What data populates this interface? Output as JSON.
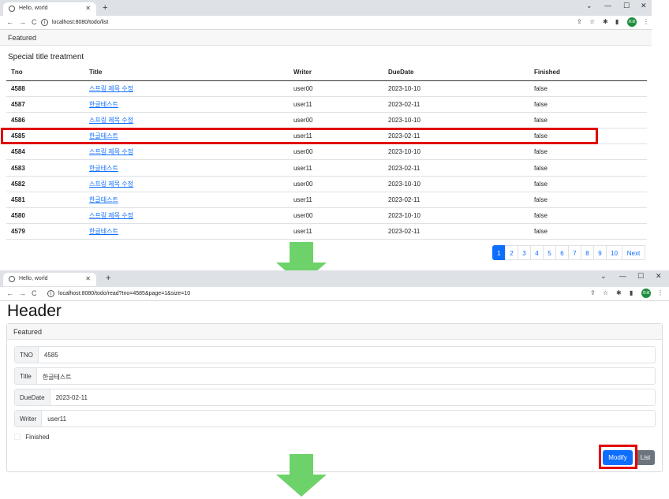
{
  "list_window": {
    "tab_title": "Hello, world",
    "url": "localhost:8080/todo/list",
    "card_header": "Featured",
    "card_title": "Special title treatment",
    "columns": [
      "Tno",
      "Title",
      "Writer",
      "DueDate",
      "Finished"
    ],
    "rows": [
      {
        "tno": "4588",
        "title": "스프링 제목 수정",
        "writer": "user00",
        "due": "2023-10-10",
        "finished": "false"
      },
      {
        "tno": "4587",
        "title": "한글테스트",
        "writer": "user11",
        "due": "2023-02-11",
        "finished": "false"
      },
      {
        "tno": "4586",
        "title": "스프링 제목 수정",
        "writer": "user00",
        "due": "2023-10-10",
        "finished": "false"
      },
      {
        "tno": "4585",
        "title": "한글테스트",
        "writer": "user11",
        "due": "2023-02-11",
        "finished": "false"
      },
      {
        "tno": "4584",
        "title": "스프링 제목 수정",
        "writer": "user00",
        "due": "2023-10-10",
        "finished": "false"
      },
      {
        "tno": "4583",
        "title": "한글테스트",
        "writer": "user11",
        "due": "2023-02-11",
        "finished": "false"
      },
      {
        "tno": "4582",
        "title": "스프링 제목 수정",
        "writer": "user00",
        "due": "2023-10-10",
        "finished": "false"
      },
      {
        "tno": "4581",
        "title": "한글테스트",
        "writer": "user11",
        "due": "2023-02-11",
        "finished": "false"
      },
      {
        "tno": "4580",
        "title": "스프링 제목 수정",
        "writer": "user00",
        "due": "2023-10-10",
        "finished": "false"
      },
      {
        "tno": "4579",
        "title": "한글테스트",
        "writer": "user11",
        "due": "2023-02-11",
        "finished": "false"
      }
    ],
    "pagination": [
      "1",
      "2",
      "3",
      "4",
      "5",
      "6",
      "7",
      "8",
      "9",
      "10",
      "Next"
    ],
    "active_page": "1",
    "highlighted_row": "4585"
  },
  "read_window": {
    "tab_title": "Hello, world",
    "url": "localhost:8080/todo/read?tno=4585&page=1&size=10",
    "heading": "Header",
    "card_header": "Featured",
    "tno_label": "TNO",
    "tno_value": "4585",
    "title_label": "Title",
    "title_value": "한글테스트",
    "due_label": "DueDate",
    "due_value": "2023-02-11",
    "writer_label": "Writer",
    "writer_value": "user11",
    "finished_label": "Finished",
    "modify_label": "Modify",
    "list_label": "List"
  },
  "chrome": {
    "new_tab": "+",
    "close_tab": "✕",
    "back": "←",
    "forward": "→",
    "reload": "C",
    "minimize": "—",
    "maximize": "☐",
    "close_window": "✕",
    "tab_menu": "⌄",
    "avatar_text": "프로"
  },
  "colors": {
    "highlight": "#e00000",
    "arrow": "#6dd26a",
    "primary": "#0d6efd",
    "secondary": "#6c757d"
  }
}
